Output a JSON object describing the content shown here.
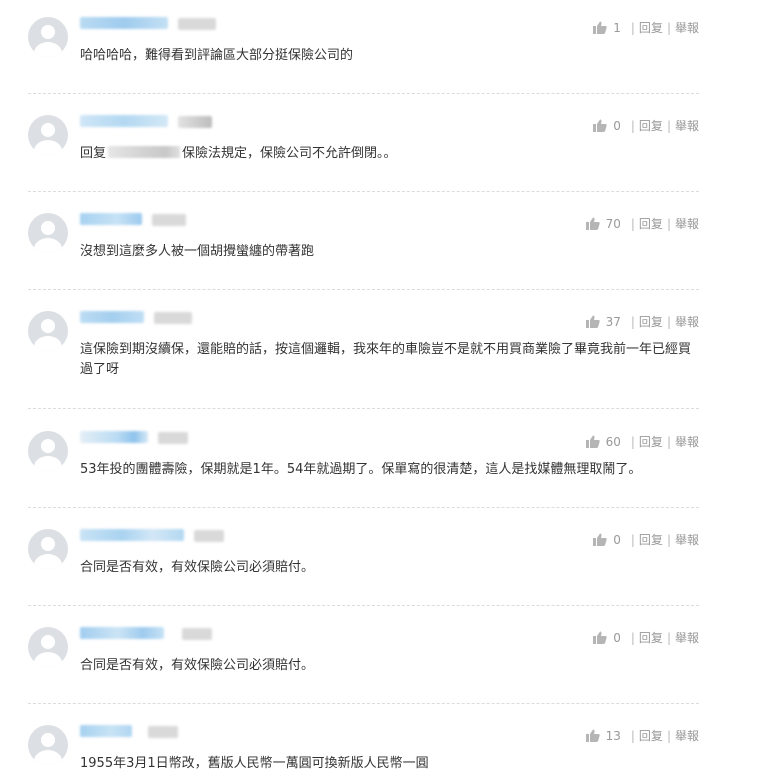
{
  "actions": {
    "reply_label": "回复",
    "report_label": "舉報",
    "separator": "|"
  },
  "comments": [
    {
      "likes": "1",
      "text": "哈哈哈哈，難得看到評論區大部分挺保險公司的"
    },
    {
      "likes": "0",
      "reply_prefix": "回复",
      "text": "保險法規定，保險公司不允許倒閉。。"
    },
    {
      "likes": "70",
      "text": "沒想到這麼多人被一個胡攪蠻纏的帶著跑"
    },
    {
      "likes": "37",
      "text": "這保險到期沒續保，還能賠的話，按這個邏輯，我來年的車險豈不是就不用買商業險了畢竟我前一年已經買過了呀"
    },
    {
      "likes": "60",
      "text": "53年投的團體壽險，保期就是1年。54年就過期了。保單寫的很清楚，這人是找媒體無理取鬧了。"
    },
    {
      "likes": "0",
      "text": "合同是否有效，有效保險公司必須賠付。"
    },
    {
      "likes": "0",
      "text": "合同是否有效，有效保險公司必須賠付。"
    },
    {
      "likes": "13",
      "text": "1955年3月1日幣改，舊版人民幣一萬圓可換新版人民幣一圓"
    }
  ],
  "colors": {
    "text": "#333333",
    "meta": "#999999",
    "divider": "#dcdcdc",
    "avatar_bg": "#dcdfe3",
    "name_blur": "#a9d3f0"
  },
  "icons": {
    "like": "thumbs-up-icon",
    "avatar": "user-avatar-icon"
  }
}
